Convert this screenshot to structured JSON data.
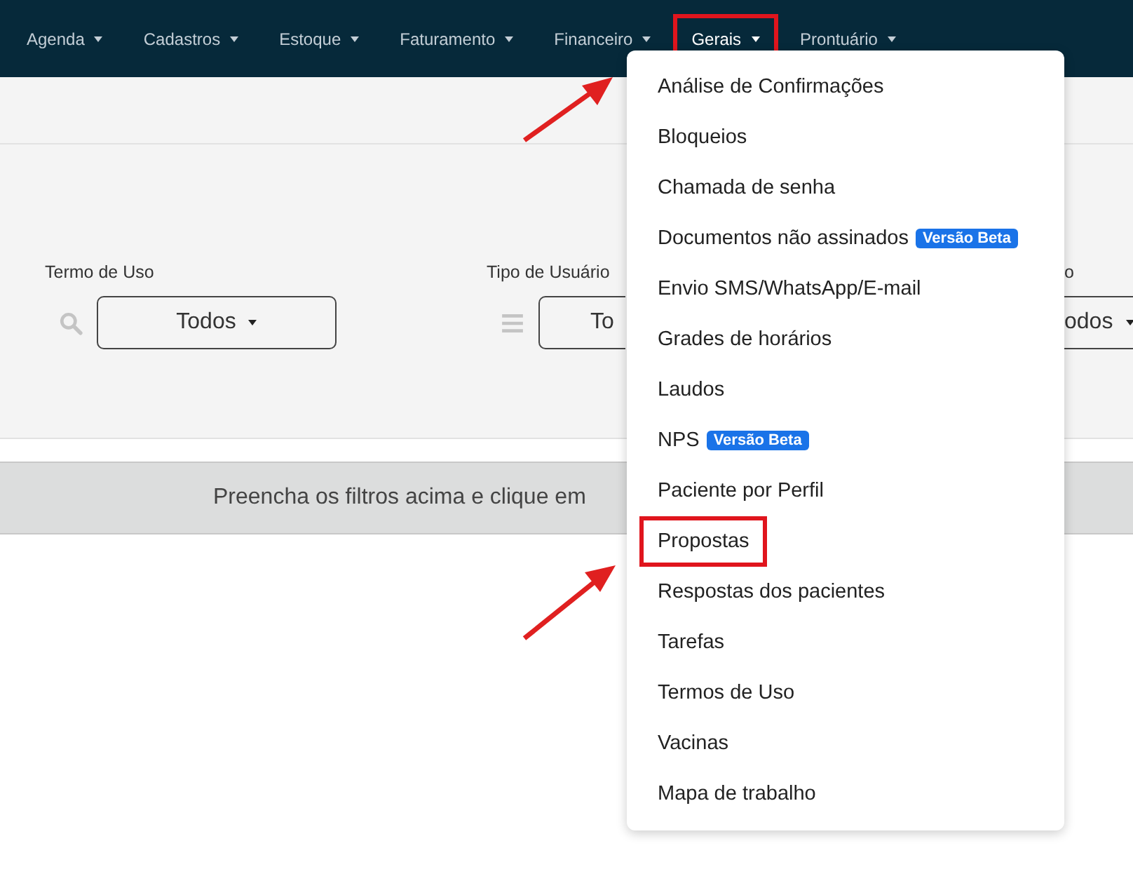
{
  "nav": [
    {
      "label": "Agenda",
      "selected": false,
      "highlighted": false
    },
    {
      "label": "Cadastros",
      "selected": false,
      "highlighted": false
    },
    {
      "label": "Estoque",
      "selected": false,
      "highlighted": false
    },
    {
      "label": "Faturamento",
      "selected": false,
      "highlighted": false
    },
    {
      "label": "Financeiro",
      "selected": false,
      "highlighted": false
    },
    {
      "label": "Gerais",
      "selected": true,
      "highlighted": true
    },
    {
      "label": "Prontuário",
      "selected": false,
      "highlighted": false
    }
  ],
  "filters": [
    {
      "label": "Termo de Uso",
      "value": "Todos",
      "kind": "search"
    },
    {
      "label": "Tipo de Usuário",
      "value": "To",
      "kind": "list"
    },
    {
      "label": "o",
      "value": "odos",
      "kind": "plain"
    }
  ],
  "message": "Preencha os filtros acima e clique em",
  "menu": [
    {
      "label": "Análise de Confirmações",
      "highlighted": false
    },
    {
      "label": "Bloqueios",
      "highlighted": false
    },
    {
      "label": "Chamada de senha",
      "highlighted": false
    },
    {
      "label": "Documentos não assinados",
      "badge": "Versão Beta",
      "highlighted": false
    },
    {
      "label": "Envio SMS/WhatsApp/E-mail",
      "highlighted": false
    },
    {
      "label": "Grades de horários",
      "highlighted": false
    },
    {
      "label": "Laudos",
      "highlighted": false
    },
    {
      "label": "NPS",
      "badge": "Versão Beta",
      "highlighted": false
    },
    {
      "label": "Paciente por Perfil",
      "highlighted": false
    },
    {
      "label": "Propostas",
      "highlighted": true
    },
    {
      "label": "Respostas dos pacientes",
      "highlighted": false
    },
    {
      "label": "Tarefas",
      "highlighted": false
    },
    {
      "label": "Termos de Uso",
      "highlighted": false
    },
    {
      "label": "Vacinas",
      "highlighted": false
    },
    {
      "label": "Mapa de trabalho",
      "highlighted": false
    }
  ]
}
